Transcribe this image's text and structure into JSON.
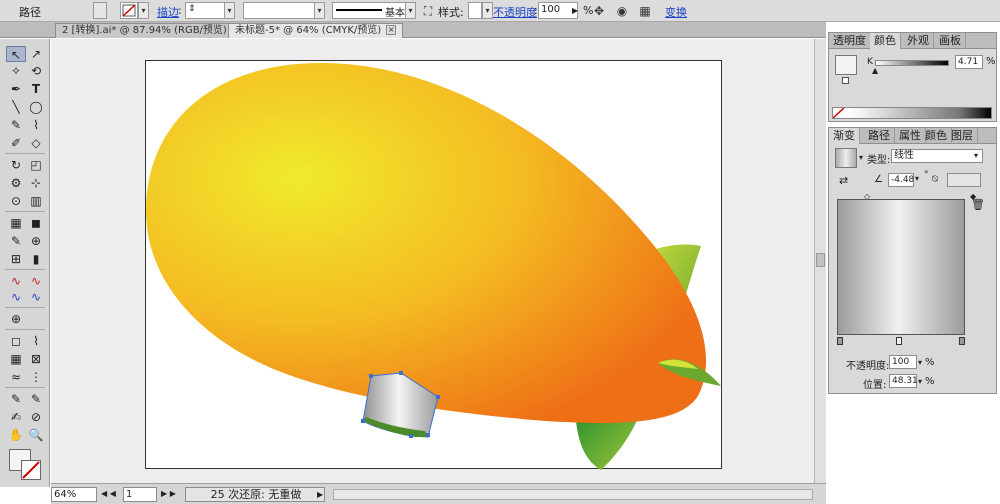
{
  "control_bar": {
    "object_label": "路径",
    "stroke_label": "描边",
    "stroke_style_label": "基本",
    "style_label": "样式:",
    "opacity_label": "不透明度",
    "opacity_value": "100",
    "opacity_unit": "%",
    "transform_link": "变换"
  },
  "tabs": [
    {
      "label": "2 [转换].ai* @ 87.94% (RGB/预览)",
      "close": "×"
    },
    {
      "label": "未标题-5* @ 64% (CMYK/预览)",
      "close": "×"
    }
  ],
  "tools": [
    "↖",
    "↗",
    "✧",
    "⟲",
    "✒",
    "T",
    "╲",
    "◯",
    "✎",
    "⌇",
    "✐",
    "◇",
    "↻",
    "◰",
    "⚙",
    "⊹",
    "⊙",
    "▥",
    "▦",
    "◼",
    "✎",
    "⊕",
    "⊞",
    "▮",
    "∿",
    "∿",
    "∿",
    "∿",
    "⊕",
    "◻",
    "⌇",
    "▦",
    "⊠",
    "≈",
    "⋮",
    "✎",
    "✎",
    "✍",
    "⊘",
    "✋",
    "🔍"
  ],
  "status_bar": {
    "zoom": "64%",
    "page": "1",
    "message": "25 次还原: 无重做"
  },
  "transparency_panel": {
    "tabs": [
      "透明度",
      "颜色",
      "外观",
      "画板"
    ],
    "active_tab": "颜色",
    "channel_label": "K",
    "channel_value": "4.71",
    "channel_unit": "%"
  },
  "gradient_panel": {
    "tabs": [
      "渐变",
      "路径",
      "属性",
      "颜色",
      "图层"
    ],
    "active_tab": "渐变",
    "type_label": "类型:",
    "type_value": "线性",
    "angle_value": "-4.48",
    "angle_unit": "°",
    "opacity_label": "不透明度:",
    "opacity_value": "100",
    "opacity_unit": "%",
    "position_label": "位置:",
    "position_value": "48.31",
    "position_unit": "%"
  },
  "colors": {
    "blimp_center": "#f0e52c",
    "blimp_edge": "#ef7f1a",
    "fin_green": "#6aa82e",
    "fin_light": "#c8dc3a",
    "selection": "#3b6fd4"
  }
}
